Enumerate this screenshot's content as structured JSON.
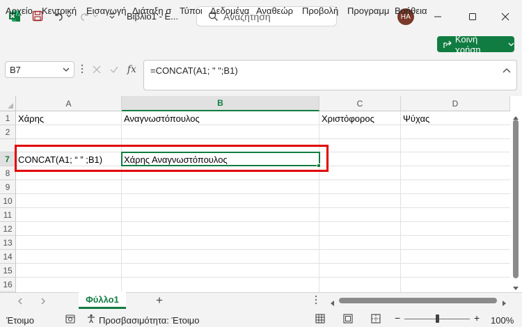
{
  "title_bar": {
    "document_title": "Βιβλίο1 - Ε...",
    "search_placeholder": "Αναζήτηση",
    "avatar_initials": "HA"
  },
  "ribbon": {
    "tabs": [
      "Αρχείο",
      "Κεντρική",
      "Εισαγωγή",
      "Διάταξη σ",
      "Τύποι",
      "Δεδομένα",
      "Αναθεώρ",
      "Προβολή",
      "Προγραμμ",
      "Βοήθεια"
    ],
    "share_label": "Κοινή χρήση"
  },
  "formula_bar": {
    "name_box": "B7",
    "formula": "=CONCAT(A1; \" \";B1)",
    "fx_label": "fx"
  },
  "grid": {
    "columns": [
      "A",
      "B",
      "C",
      "D"
    ],
    "rows": [
      "1",
      "2",
      "7",
      "8",
      "9",
      "10",
      "11",
      "12",
      "13",
      "14",
      "15",
      "16"
    ],
    "cells": {
      "A1": "Χάρης",
      "B1": "Αναγνωστόπουλος",
      "C1": "Χριστόφορος",
      "D1": "Ψύχας",
      "A7": "CONCAT(A1; “ ” ;B1)",
      "B7": "Χάρης Αναγνωστόπουλος"
    }
  },
  "sheets": {
    "active": "Φύλλο1",
    "add_label": "+"
  },
  "status_bar": {
    "ready": "Έτοιμο",
    "accessibility": "Προσβασιμότητα: Έτοιμο",
    "zoom": "100%",
    "zoom_minus": "−",
    "zoom_plus": "+"
  },
  "colors": {
    "accent": "#107c41",
    "highlight": "#e00000"
  }
}
